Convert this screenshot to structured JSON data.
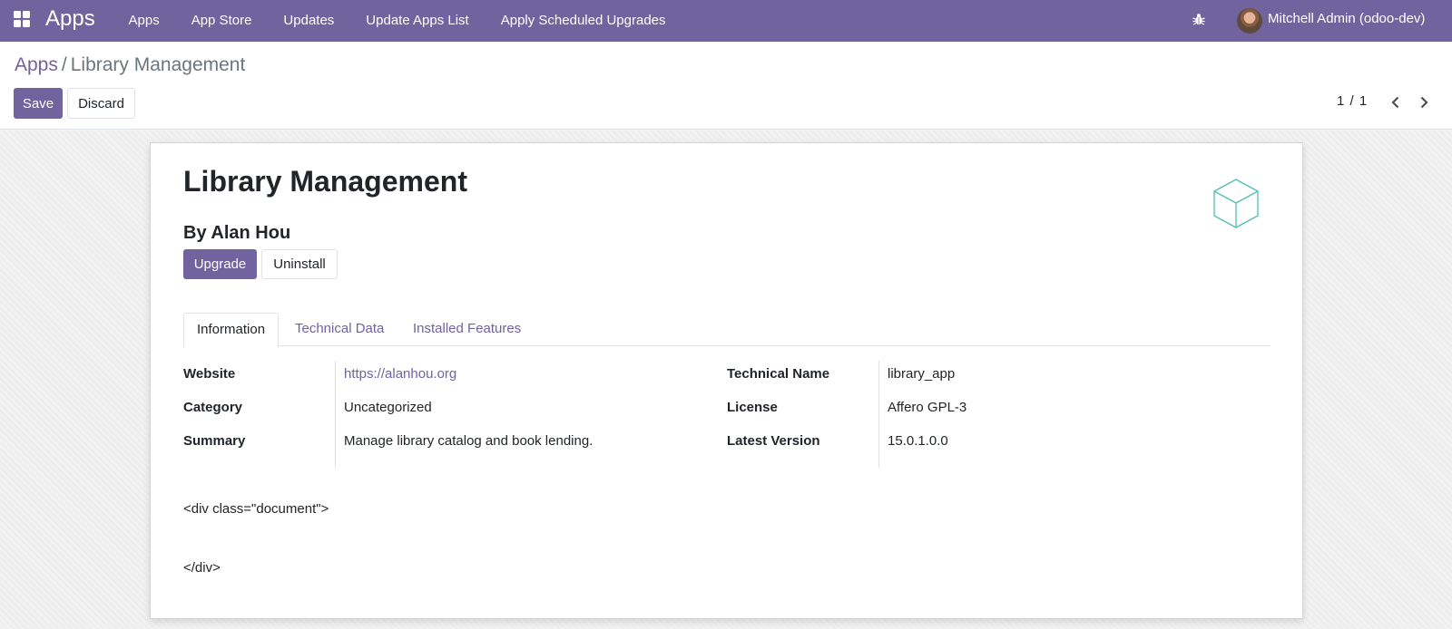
{
  "navbar": {
    "brand": "Apps",
    "menu": [
      "Apps",
      "App Store",
      "Updates",
      "Update Apps List",
      "Apply Scheduled Upgrades"
    ],
    "user_name": "Mitchell Admin (odoo-dev)",
    "bg_color": "#71639e"
  },
  "breadcrumb": {
    "parent": "Apps",
    "separator": "/",
    "current": "Library Management"
  },
  "control": {
    "save_label": "Save",
    "discard_label": "Discard",
    "pager": "1 / 1"
  },
  "module": {
    "title": "Library Management",
    "author": "By Alan Hou",
    "upgrade_label": "Upgrade",
    "uninstall_label": "Uninstall",
    "icon": "cube-icon"
  },
  "tabs": [
    "Information",
    "Technical Data",
    "Installed Features"
  ],
  "fields_left": [
    {
      "label": "Website",
      "value": "https://alanhou.org"
    },
    {
      "label": "Category",
      "value": "Uncategorized"
    },
    {
      "label": "Summary",
      "value": "Manage library catalog and book lending."
    }
  ],
  "fields_right": [
    {
      "label": "Technical Name",
      "value": "library_app"
    },
    {
      "label": "License",
      "value": "Affero GPL-3"
    },
    {
      "label": "Latest Version",
      "value": "15.0.1.0.0"
    }
  ],
  "description": {
    "open_tag": "<div class=\"document\">",
    "close_tag": "</div>"
  },
  "colors": {
    "accent": "#71639e",
    "icon_teal": "#4fbfb5"
  }
}
